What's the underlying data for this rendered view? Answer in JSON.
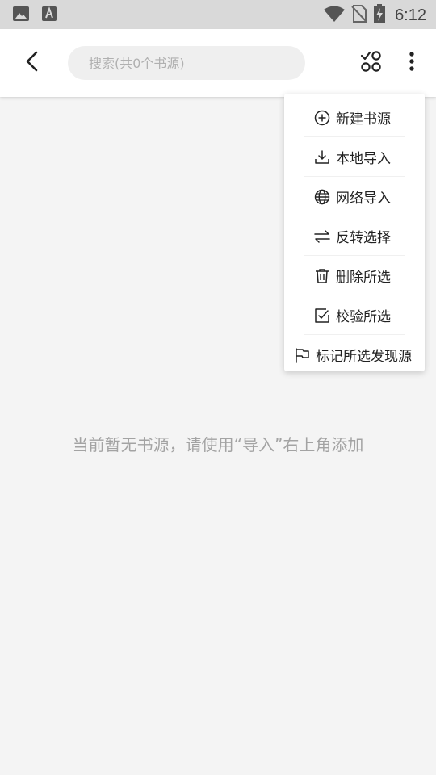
{
  "status_bar": {
    "time": "6:12",
    "icons": [
      "image-icon",
      "font-icon",
      "wifi-icon",
      "no-sim-icon",
      "battery-charging-icon"
    ]
  },
  "toolbar": {
    "back_icon": "arrow-back-icon",
    "search_placeholder": "搜索(共0个书源)",
    "search_value": "",
    "group_icon": "group-filter-icon",
    "more_icon": "more-vertical-icon"
  },
  "main": {
    "empty_message": "当前暂无书源，请使用“导入”右上角添加"
  },
  "menu": {
    "items": [
      {
        "label": "新建书源",
        "icon": "add-circle-icon"
      },
      {
        "label": "本地导入",
        "icon": "download-icon"
      },
      {
        "label": "网络导入",
        "icon": "globe-icon"
      },
      {
        "label": "反转选择",
        "icon": "swap-icon"
      },
      {
        "label": "删除所选",
        "icon": "trash-icon"
      },
      {
        "label": "校验所选",
        "icon": "check-box-icon"
      },
      {
        "label": "标记所选发现源",
        "icon": "flag-icon"
      }
    ]
  },
  "colors": {
    "status_bar_bg": "#d9d9d9",
    "toolbar_bg": "#ffffff",
    "page_bg": "#f4f4f4",
    "search_bg": "#efefef",
    "empty_text": "#a3a3a3",
    "menu_text": "#222222"
  }
}
